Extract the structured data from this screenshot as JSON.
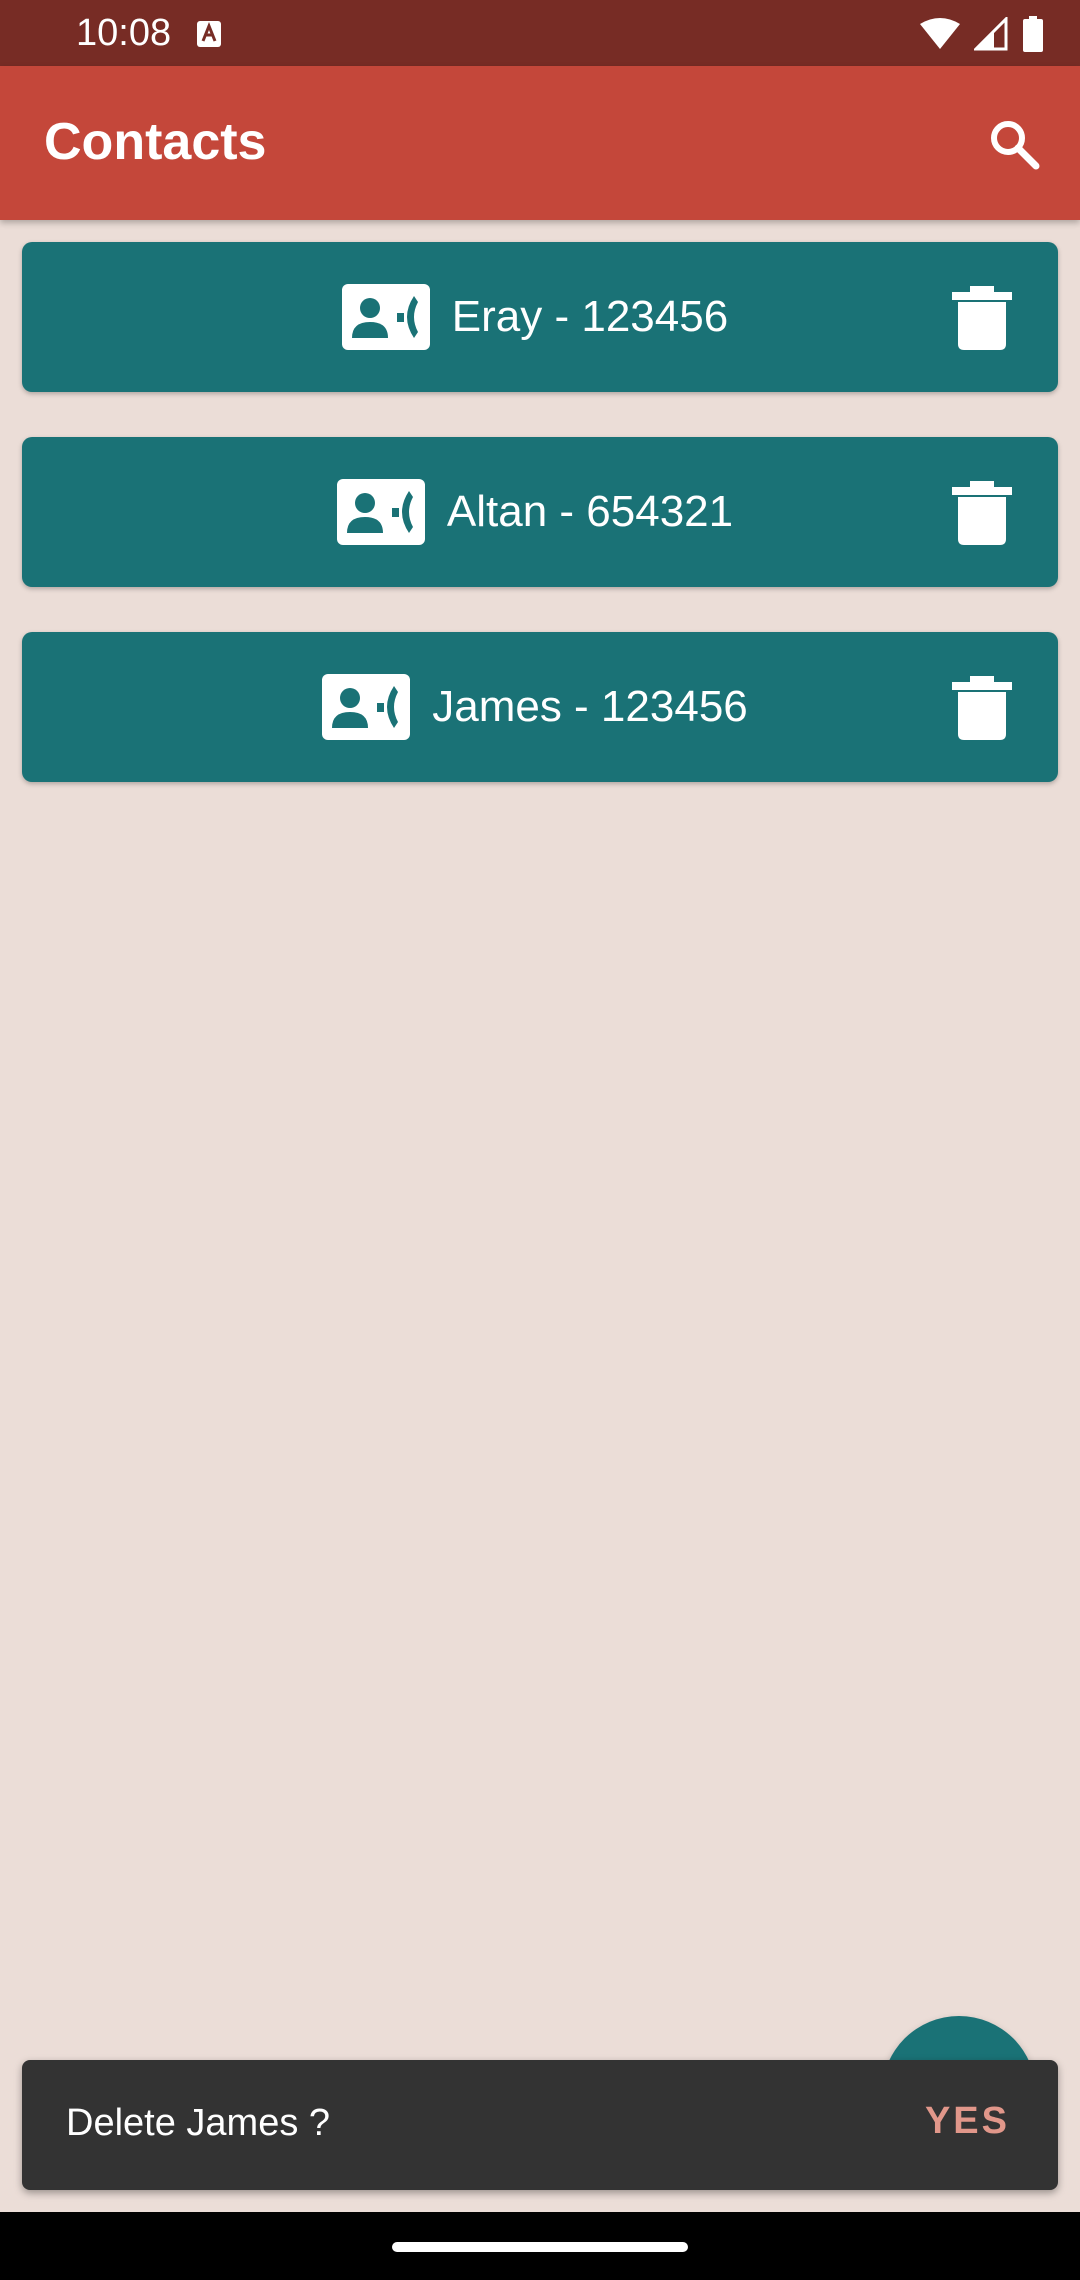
{
  "status_bar": {
    "time": "10:08",
    "notification_icon": "keyboard-a-icon",
    "icons": [
      "wifi-icon",
      "signal-icon",
      "battery-icon"
    ]
  },
  "app_bar": {
    "title": "Contacts",
    "search_icon": "search-icon"
  },
  "contacts": [
    {
      "label": "Eray - 123456",
      "icon": "contact-phone-icon",
      "action_icon": "trash-icon"
    },
    {
      "label": "Altan - 654321",
      "icon": "contact-phone-icon",
      "action_icon": "trash-icon"
    },
    {
      "label": "James - 123456",
      "icon": "contact-phone-icon",
      "action_icon": "trash-icon"
    }
  ],
  "snackbar": {
    "message": "Delete James ?",
    "action": "YES"
  },
  "colors": {
    "status_bar": "#772C25",
    "app_bar": "#C4473A",
    "background": "#EBDDD7",
    "card": "#1A7276",
    "snackbar": "#333333",
    "snackbar_action": "#E1978A"
  }
}
